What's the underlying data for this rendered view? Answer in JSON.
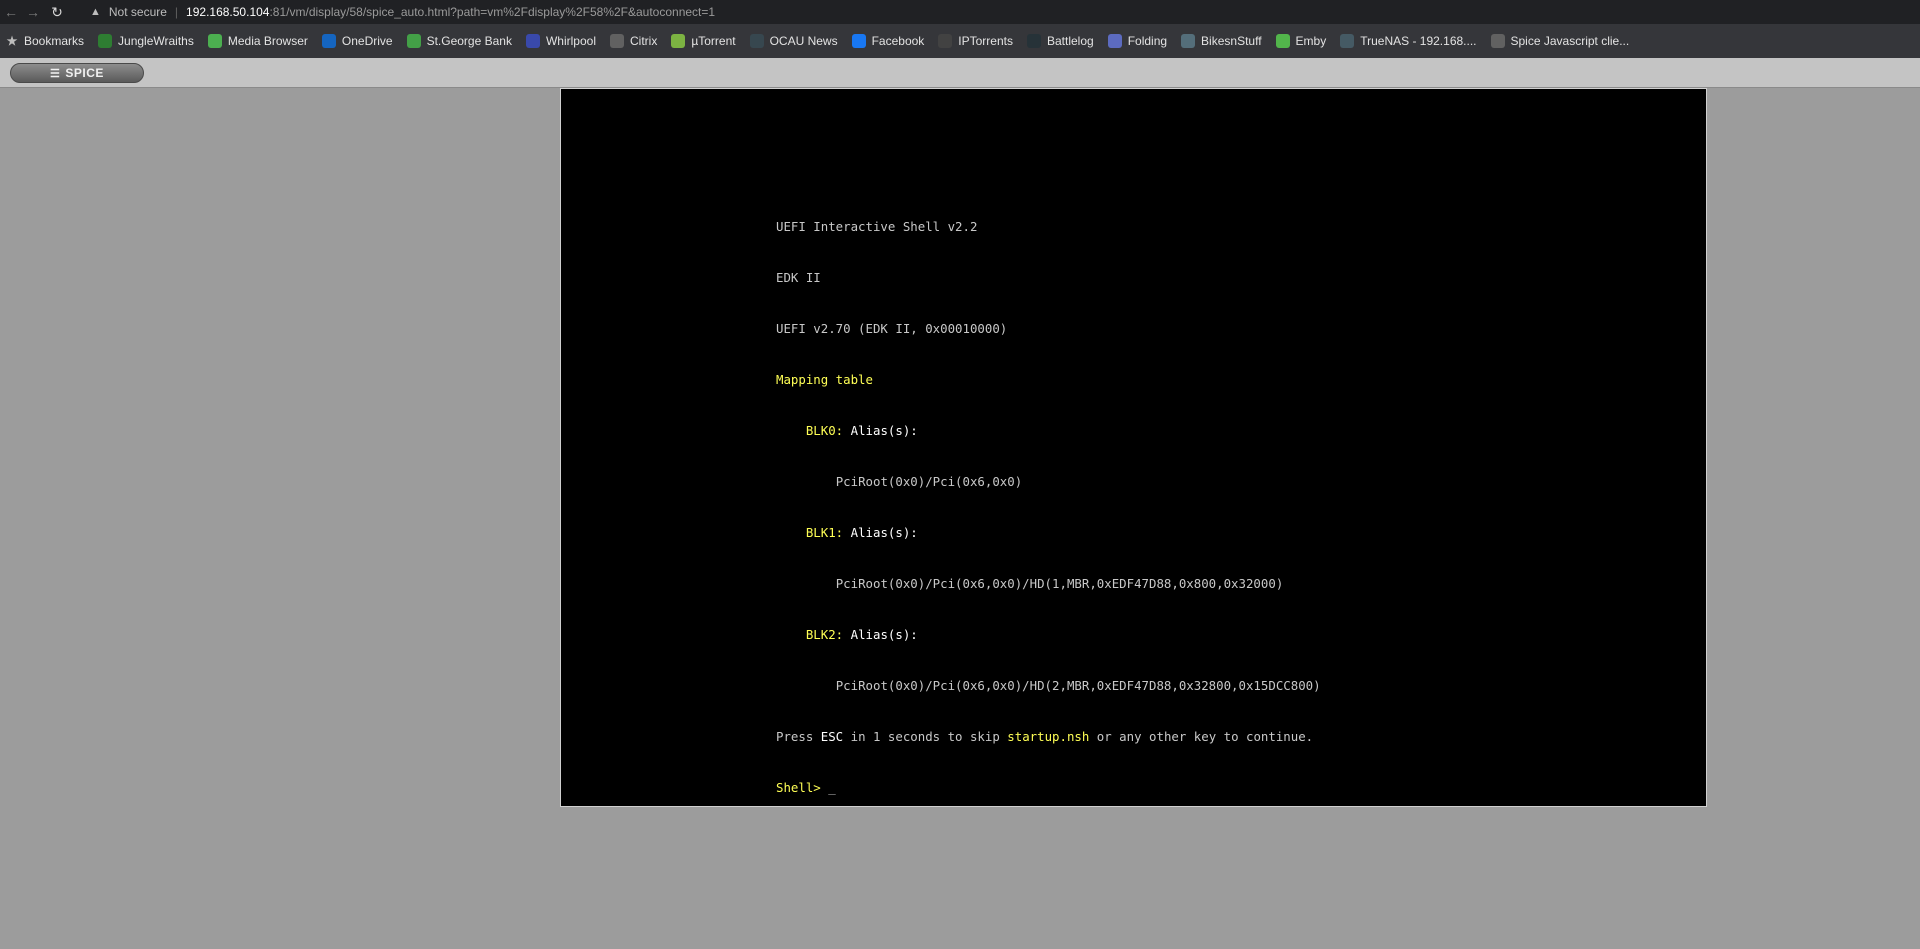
{
  "browser": {
    "not_secure": "Not secure",
    "url_host": "192.168.50.104",
    "url_rest": ":81/vm/display/58/spice_auto.html?path=vm%2Fdisplay%2F58%2F&autoconnect=1"
  },
  "bookmarks": [
    {
      "label": "Bookmarks",
      "icon": "star-icon",
      "color": ""
    },
    {
      "label": "JungleWraiths",
      "icon": "jungle-icon",
      "color": "#2e7d32"
    },
    {
      "label": "Media Browser",
      "icon": "media-icon",
      "color": "#4caf50"
    },
    {
      "label": "OneDrive",
      "icon": "cloud-icon",
      "color": "#1565c0"
    },
    {
      "label": "St.George Bank",
      "icon": "bank-icon",
      "color": "#43a047"
    },
    {
      "label": "Whirlpool",
      "icon": "whirlpool-icon",
      "color": "#3949ab"
    },
    {
      "label": "Citrix",
      "icon": "citrix-icon",
      "color": "#616161"
    },
    {
      "label": "µTorrent",
      "icon": "torrent-icon",
      "color": "#7cb342"
    },
    {
      "label": "OCAU News",
      "icon": "ocau-icon",
      "color": "#37474f"
    },
    {
      "label": "Facebook",
      "icon": "facebook-icon",
      "color": "#1877f2"
    },
    {
      "label": "IPTorrents",
      "icon": "ipt-icon",
      "color": "#424242"
    },
    {
      "label": "Battlelog",
      "icon": "battlelog-icon",
      "color": "#263238"
    },
    {
      "label": "Folding",
      "icon": "folding-icon",
      "color": "#5c6bc0"
    },
    {
      "label": "BikesnStuff",
      "icon": "bikes-icon",
      "color": "#546e7a"
    },
    {
      "label": "Emby",
      "icon": "emby-icon",
      "color": "#52b54b"
    },
    {
      "label": "TrueNAS - 192.168....",
      "icon": "truenas-icon",
      "color": "#455a64"
    },
    {
      "label": "Spice Javascript clie...",
      "icon": "globe-icon",
      "color": "#616161"
    }
  ],
  "spice": {
    "button_label": "SPICE",
    "menu_glyph": "☰"
  },
  "console": {
    "l1": "UEFI Interactive Shell v2.2",
    "l2": "EDK II",
    "l3": "UEFI v2.70 (EDK II, 0x00010000)",
    "l4": "Mapping table",
    "blk0_name": "BLK0:",
    "blk0_alias": " Alias(s):",
    "blk0_path": "PciRoot(0x0)/Pci(0x6,0x0)",
    "blk1_name": "BLK1:",
    "blk1_alias": " Alias(s):",
    "blk1_path": "PciRoot(0x0)/Pci(0x6,0x0)/HD(1,MBR,0xEDF47D88,0x800,0x32000)",
    "blk2_name": "BLK2:",
    "blk2_alias": " Alias(s):",
    "blk2_path": "PciRoot(0x0)/Pci(0x6,0x0)/HD(2,MBR,0xEDF47D88,0x32800,0x15DCC800)",
    "press_a": "Press ",
    "press_esc": "ESC",
    "press_b": " in 1 seconds to skip ",
    "press_file": "startup.nsh",
    "press_c": " or any other key to continue.",
    "prompt": "Shell>",
    "cursor": "_"
  }
}
